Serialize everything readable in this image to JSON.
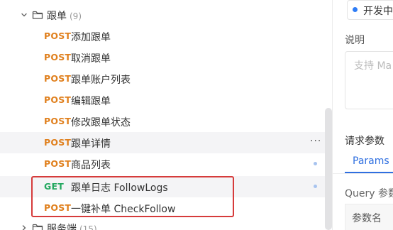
{
  "tree": {
    "folder": {
      "name": "跟单",
      "count": "(9)"
    },
    "items": [
      {
        "method": "POST",
        "name": "添加跟单"
      },
      {
        "method": "POST",
        "name": "取消跟单"
      },
      {
        "method": "POST",
        "name": "跟单账户列表"
      },
      {
        "method": "POST",
        "name": "编辑跟单"
      },
      {
        "method": "POST",
        "name": "修改跟单状态"
      },
      {
        "method": "POST",
        "name": "跟单详情",
        "more": "···"
      },
      {
        "method": "POST",
        "name": "商品列表"
      },
      {
        "method": "GET",
        "name": "跟单日志 FollowLogs"
      },
      {
        "method": "POST",
        "name": "一键补单 CheckFollow"
      }
    ],
    "next_folder": {
      "name": "服务端",
      "count": "(15)"
    }
  },
  "detail": {
    "status": "开发中",
    "description_label": "说明",
    "description_placeholder": "支持 Ma",
    "request_params_label": "请求参数",
    "tabs": [
      "Params"
    ],
    "query_label": "Query 参数",
    "param_name_header": "参数名"
  },
  "colors": {
    "post": "#e0801e",
    "get": "#24a860",
    "accent": "#2f6fe0",
    "highlight_box": "#d63b3b"
  }
}
